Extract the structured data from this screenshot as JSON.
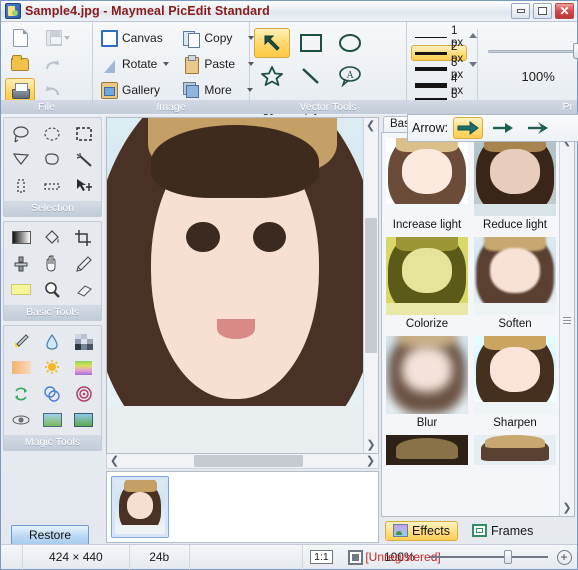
{
  "window": {
    "title": "Sample4.jpg - Maymeal PicEdit Standard",
    "app_icon": "app-icon",
    "minimize_label": "–",
    "maximize_label": "□",
    "close_label": "✕"
  },
  "ribbon": {
    "groups": [
      {
        "name": "File",
        "label": "File",
        "buttons": [
          {
            "name": "new",
            "icon": "new-document-icon",
            "enabled": true,
            "selected": false
          },
          {
            "name": "save",
            "icon": "save-icon",
            "enabled": false,
            "selected": false,
            "has_dropdown": true
          },
          {
            "name": "open",
            "icon": "open-folder-icon",
            "enabled": true,
            "selected": false
          },
          {
            "name": "redo",
            "icon": "redo-arrow-icon",
            "enabled": false,
            "selected": false
          },
          {
            "name": "print",
            "icon": "printer-icon",
            "enabled": true,
            "selected": true
          },
          {
            "name": "undo",
            "icon": "undo-arrow-icon",
            "enabled": false,
            "selected": false
          }
        ]
      },
      {
        "name": "Image",
        "label": "Image",
        "buttons": [
          {
            "name": "canvas",
            "label": "Canvas",
            "icon": "canvas-square-icon",
            "has_dropdown": false
          },
          {
            "name": "copy",
            "label": "Copy",
            "icon": "copy-icon",
            "has_dropdown": true
          },
          {
            "name": "rotate",
            "label": "Rotate",
            "icon": "rotate-icon",
            "has_dropdown": true
          },
          {
            "name": "paste",
            "label": "Paste",
            "icon": "clipboard-icon",
            "has_dropdown": true
          },
          {
            "name": "gallery",
            "label": "Gallery",
            "icon": "gallery-icon",
            "has_dropdown": false
          },
          {
            "name": "more",
            "label": "More",
            "icon": "more-layers-icon",
            "has_dropdown": true
          }
        ]
      },
      {
        "name": "Vector Tools",
        "label": "Vector Tools",
        "buttons": [
          {
            "name": "arrow",
            "icon": "arrow-tool-icon",
            "selected": true
          },
          {
            "name": "rectangle",
            "icon": "rectangle-tool-icon",
            "selected": false
          },
          {
            "name": "ellipse",
            "icon": "ellipse-tool-icon",
            "selected": false
          },
          {
            "name": "star",
            "icon": "star-tool-icon",
            "selected": false
          },
          {
            "name": "line",
            "icon": "line-tool-icon",
            "selected": false
          },
          {
            "name": "callout",
            "icon": "callout-tool-icon",
            "selected": false
          },
          {
            "name": "pen",
            "icon": "pen-tool-icon",
            "selected": false
          },
          {
            "name": "text",
            "icon": "text-tool-icon",
            "selected": false,
            "glyph": "A"
          }
        ]
      }
    ],
    "line_width": {
      "options": [
        {
          "label": "1 px",
          "thickness": 1,
          "selected": false
        },
        {
          "label": "2 px",
          "thickness": 3,
          "selected": true
        },
        {
          "label": "3 px",
          "thickness": 4,
          "selected": false
        },
        {
          "label": "4 px",
          "thickness": 5,
          "selected": false
        },
        {
          "label": "5 px",
          "thickness": 6,
          "selected": false
        }
      ]
    },
    "zoom_panel": {
      "percent": "100%",
      "group_label": "Pr"
    }
  },
  "arrow_popup": {
    "label": "Arrow:",
    "styles": [
      {
        "name": "arrow-style-solid",
        "selected": true
      },
      {
        "name": "arrow-style-thin",
        "selected": false
      },
      {
        "name": "arrow-style-swept",
        "selected": false
      }
    ]
  },
  "left_panels": [
    {
      "name": "selection",
      "label": "Selection",
      "tools": [
        {
          "name": "lasso-tool",
          "icon": "lasso-icon"
        },
        {
          "name": "ellipse-select-tool",
          "icon": "ellipse-select-icon"
        },
        {
          "name": "rectangle-select-tool",
          "icon": "rectangle-select-icon"
        },
        {
          "name": "polygon-select-tool",
          "icon": "polygon-select-icon"
        },
        {
          "name": "freeform-select-tool",
          "icon": "freeform-select-icon"
        },
        {
          "name": "magic-wand-tool",
          "icon": "magic-wand-icon"
        },
        {
          "name": "vertical-marquee-tool",
          "icon": "vertical-marquee-icon"
        },
        {
          "name": "horizontal-marquee-tool",
          "icon": "horizontal-marquee-icon"
        },
        {
          "name": "move-selection-tool",
          "icon": "move-selection-icon"
        }
      ]
    },
    {
      "name": "basic-tools",
      "label": "Basic Tools",
      "tools": [
        {
          "name": "gradient-tool",
          "icon": "gradient-icon"
        },
        {
          "name": "paint-bucket-tool",
          "icon": "paint-bucket-icon"
        },
        {
          "name": "crop-tool",
          "icon": "crop-icon"
        },
        {
          "name": "clone-stamp-tool",
          "icon": "clone-stamp-icon"
        },
        {
          "name": "hand-tool",
          "icon": "hand-icon"
        },
        {
          "name": "pencil-tool",
          "icon": "pencil-icon"
        },
        {
          "name": "highlighter-tool",
          "icon": "highlighter-icon"
        },
        {
          "name": "magnifier-tool",
          "icon": "magnifier-icon"
        },
        {
          "name": "eraser-tool",
          "icon": "eraser-icon"
        }
      ]
    },
    {
      "name": "magic-tools",
      "label": "Magic Tools",
      "tools": [
        {
          "name": "color-picker-tool",
          "icon": "color-picker-icon"
        },
        {
          "name": "blur-drop-tool",
          "icon": "water-drop-icon"
        },
        {
          "name": "pixelate-tool",
          "icon": "pixelate-icon"
        },
        {
          "name": "warm-gradient-tool",
          "icon": "warm-gradient-icon"
        },
        {
          "name": "brightness-tool",
          "icon": "sun-icon"
        },
        {
          "name": "hue-tool",
          "icon": "hue-spectrum-icon"
        },
        {
          "name": "rotate-color-tool",
          "icon": "recycle-arrows-icon"
        },
        {
          "name": "overlap-tool",
          "icon": "overlapping-circles-icon"
        },
        {
          "name": "rings-tool",
          "icon": "concentric-rings-icon"
        },
        {
          "name": "red-eye-tool",
          "icon": "red-eye-icon"
        },
        {
          "name": "photo-effect-tool",
          "icon": "photo-frame-icon"
        },
        {
          "name": "photo-enhance-tool",
          "icon": "photo-enhance-icon"
        }
      ]
    }
  ],
  "restore_button": {
    "label": "Restore"
  },
  "canvas": {
    "scroll_up": "▲",
    "scroll_down": "▼",
    "scroll_left": "❮",
    "scroll_right": "❯"
  },
  "effects_panel": {
    "tabs": [
      {
        "name": "basic",
        "label": "Bas"
      }
    ],
    "scroll_up": "▲",
    "scroll_down": "▼",
    "effects": [
      {
        "name": "increase-light",
        "label": "Increase light",
        "style": "increase"
      },
      {
        "name": "reduce-light",
        "label": "Reduce light",
        "style": "reduce"
      },
      {
        "name": "colorize",
        "label": "Colorize",
        "style": "colorize"
      },
      {
        "name": "soften",
        "label": "Soften",
        "style": "soften"
      },
      {
        "name": "blur",
        "label": "Blur",
        "style": "blur"
      },
      {
        "name": "sharpen",
        "label": "Sharpen",
        "style": "sharpen"
      },
      {
        "name": "effect-row4-left",
        "label": "",
        "style": "noise"
      },
      {
        "name": "effect-row4-right",
        "label": "",
        "style": "normal"
      }
    ],
    "bottom_tabs": [
      {
        "name": "effects",
        "label": "Effects",
        "icon": "effects-icon",
        "selected": true
      },
      {
        "name": "frames",
        "label": "Frames",
        "icon": "frames-icon",
        "selected": false
      }
    ]
  },
  "status_bar": {
    "dimensions": "424 × 440",
    "color_depth": "24b",
    "ratio_button": "1:1",
    "fit_button": "fit-to-window-icon",
    "zoom_percent": "100%",
    "watermark": "[Unregistered]",
    "zoom_in": "+"
  },
  "colors": {
    "title_text": "#8b1a1a",
    "highlight": "#ffd76a",
    "watermark": "#c02626",
    "panel_label_bg": "#c2ccd9"
  }
}
